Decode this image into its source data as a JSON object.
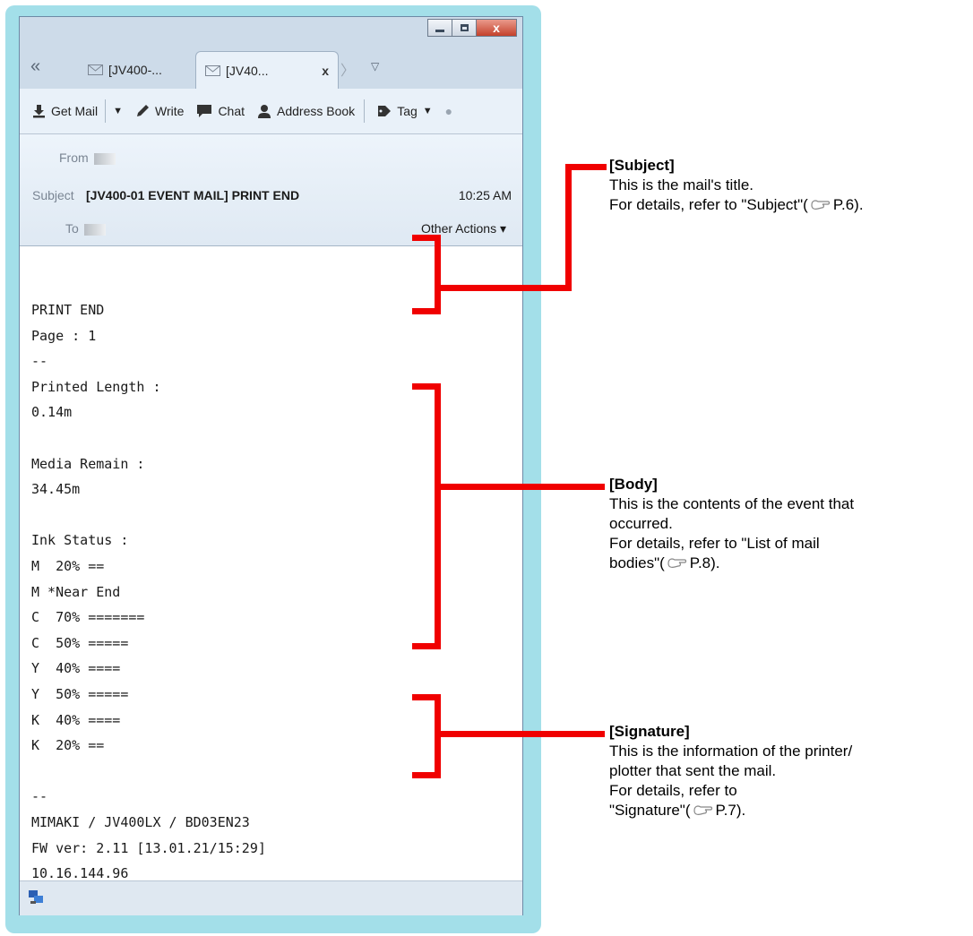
{
  "window": {
    "close_glyph": "x"
  },
  "tabs": [
    {
      "label": "[JV400-...",
      "active": false,
      "icon": "envelope-icon"
    },
    {
      "label": "[JV40...",
      "active": true,
      "icon": "envelope-icon",
      "close": "x"
    }
  ],
  "toolbar": {
    "get_mail": "Get Mail",
    "write": "Write",
    "chat": "Chat",
    "address_book": "Address Book",
    "tag": "Tag"
  },
  "header": {
    "from_label": "From",
    "subject_label": "Subject",
    "subject": "[JV400-01 EVENT MAIL] PRINT END",
    "time": "10:25 AM",
    "to_label": "To",
    "other_actions": "Other Actions ▾"
  },
  "body_lines": [
    "PRINT END",
    "Page : 1",
    "--",
    "Printed Length :",
    "0.14m",
    "",
    "Media Remain :",
    "34.45m",
    "",
    "Ink Status :",
    "M  20% ==",
    "M *Near End",
    "C  70% =======",
    "C  50% =====",
    "Y  40% ====",
    "Y  50% =====",
    "K  40% ====",
    "K  20% ==",
    "",
    "--",
    "MIMAKI / JV400LX / BD03EN23",
    "FW ver: 2.11 [13.01.21/15:29]",
    "10.16.144.96",
    "--"
  ],
  "annotations": {
    "subject": {
      "title": "[Subject]",
      "line1": "This is the mail's title.",
      "line2_prefix": "For details, refer to \"Subject\"(",
      "page": "P.6).",
      "icon": "reference-hand-icon"
    },
    "body": {
      "title": "[Body]",
      "line1": "This is the contents of the event that",
      "line2": "occurred.",
      "line3": "For details, refer to \"List of mail",
      "line4_prefix": "bodies\"(",
      "page": "P.8).",
      "icon": "reference-hand-icon"
    },
    "signature": {
      "title": "[Signature]",
      "line1": "This is the information of the printer/",
      "line2": "plotter that sent the mail.",
      "line3": "For details, refer to",
      "line4_prefix": "\"Signature\"(",
      "page": "P.7).",
      "icon": "reference-hand-icon"
    }
  },
  "colors": {
    "frame": "#a3dfe9",
    "annotation": "#f00000"
  }
}
